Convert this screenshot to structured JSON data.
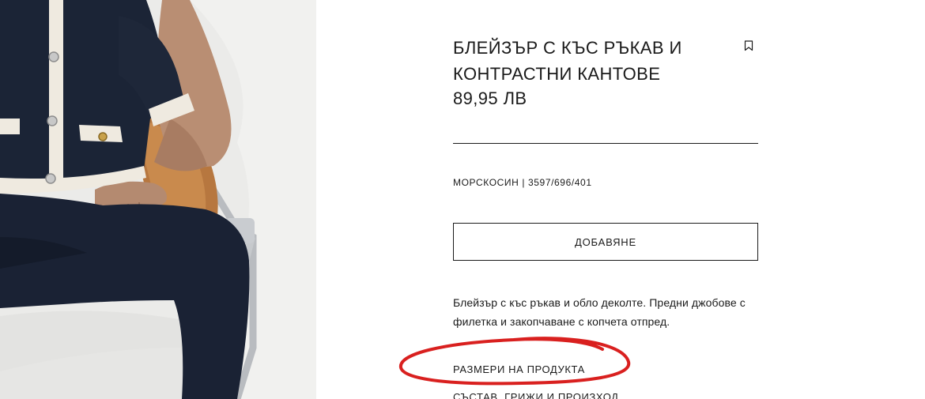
{
  "product": {
    "title": "БЛЕЙЗЪР С КЪС РЪКАВ И КОНТРАСТНИ КАНТОВЕ",
    "price": "89,95 ЛВ",
    "color_and_reference": "МОРСКОСИН | 3597/696/401",
    "add_button_label": "ДОБАВЯНЕ",
    "description": "Блейзър с къс ръкав и обло деколте. Предни джобове с филетка и закопчаване с копчета отпред.",
    "bookmark_icon": "bookmark-icon"
  },
  "links": {
    "sizes_label": "РАЗМЕРИ НА ПРОДУКТА",
    "composition_label": "СЪСТАВ, ГРИЖИ И ПРОИЗХОД"
  },
  "colors": {
    "annotation_red": "#d9201f",
    "garment_navy": "#1b2436",
    "trim_cream": "#efeae0"
  }
}
